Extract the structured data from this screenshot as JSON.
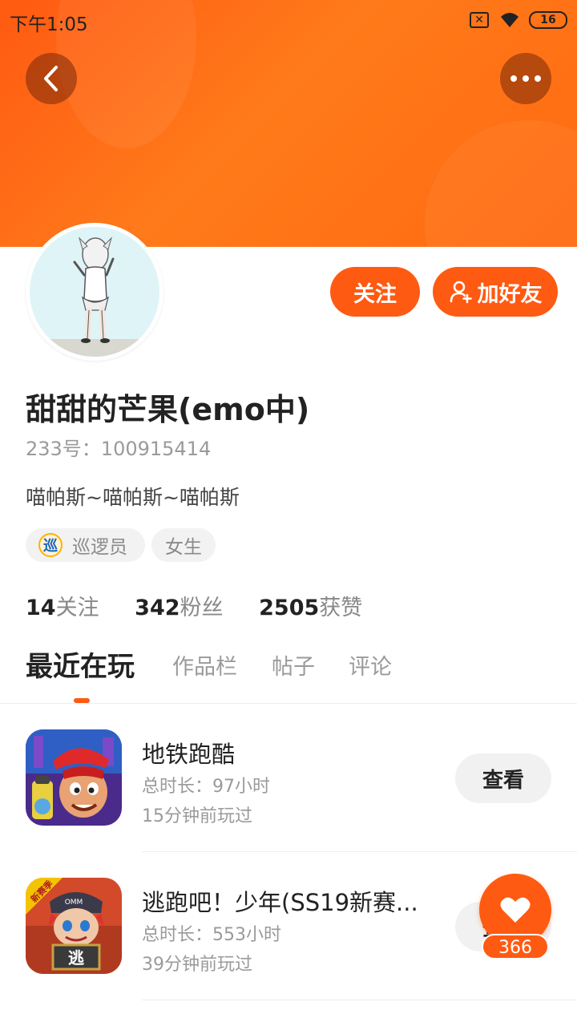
{
  "status_bar": {
    "time": "下午1:05",
    "battery": "16",
    "sim_icon": "sim-off-icon",
    "wifi_icon": "wifi-icon"
  },
  "header": {
    "back_icon": "chevron-left-icon",
    "more_icon": "more-horizontal-icon",
    "accent_color": "#ff5a12"
  },
  "profile": {
    "username": "甜甜的芒果(emo中)",
    "uid": "233号：100915414",
    "bio": "喵帕斯~喵帕斯~喵帕斯",
    "tags": [
      {
        "label": "巡逻员",
        "icon": "patrol-badge-icon",
        "icon_char": "巡"
      },
      {
        "label": "女生"
      }
    ],
    "stats": [
      {
        "value": "14",
        "label": "关注"
      },
      {
        "value": "342",
        "label": "粉丝"
      },
      {
        "value": "2505",
        "label": "获赞"
      }
    ]
  },
  "actions": {
    "follow_label": "关注",
    "add_friend_label": "加好友",
    "add_friend_icon": "add-user-icon"
  },
  "tabs": [
    {
      "label": "最近在玩",
      "active": true
    },
    {
      "label": "作品栏"
    },
    {
      "label": "帖子"
    },
    {
      "label": "评论"
    }
  ],
  "games": [
    {
      "title": "地铁跑酷",
      "duration": "总时长：97小时",
      "last_played": "15分钟前玩过",
      "button": "查看"
    },
    {
      "title": "逃跑吧！少年(SS19新赛...",
      "duration": "总时长：553小时",
      "last_played": "39分钟前玩过",
      "button": "查看",
      "icon_badge": "新赛季",
      "icon_sign": "逃",
      "icon_cap": "OMM"
    }
  ],
  "like_fab": {
    "icon": "heart-icon",
    "count": "366"
  }
}
